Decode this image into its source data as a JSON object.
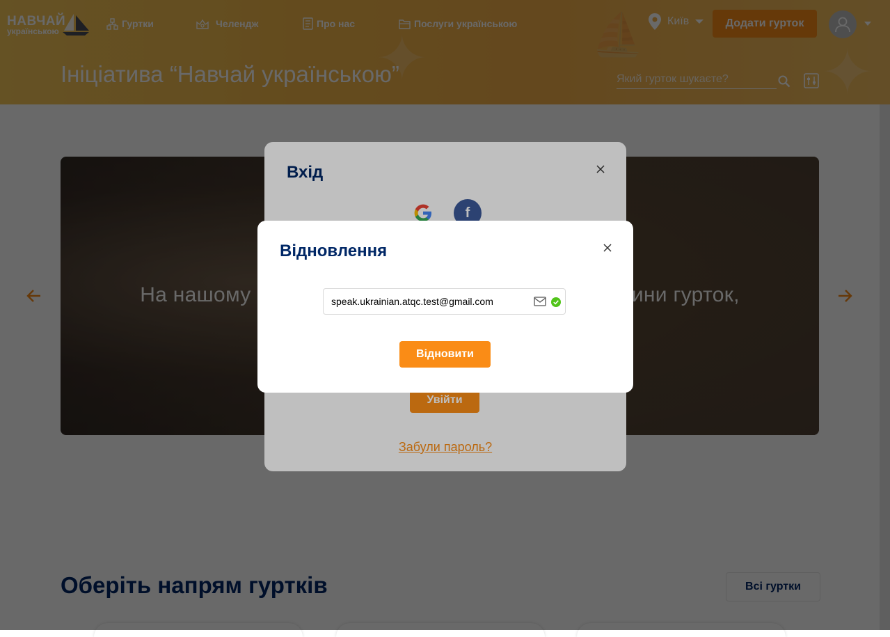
{
  "header": {
    "logo_line1": "НАВЧАЙ",
    "logo_line2": "українською",
    "nav": [
      {
        "label": "Гуртки",
        "icon": "clubs-icon"
      },
      {
        "label": "Челендж",
        "icon": "challenge-icon"
      },
      {
        "label": "Про нас",
        "icon": "about-icon"
      },
      {
        "label": "Послуги українською",
        "icon": "folder-icon"
      }
    ],
    "city": "Київ",
    "add_club_label": "Додати гурток",
    "page_title": "Ініціатива “Навчай українською”",
    "search_placeholder": "Який гурток шукаєте?"
  },
  "carousel": {
    "text_left": "На нашому",
    "text_right": "ини гурток,"
  },
  "section": {
    "title": "Оберіть напрям гуртків",
    "all_clubs_label": "Всі гуртки"
  },
  "login_modal": {
    "title": "Вхід",
    "login_label": "Увійти",
    "forgot_label": "Забули пароль?"
  },
  "recovery_modal": {
    "title": "Відновлення",
    "email_value": "speak.ukrainian.atqc.test@gmail.com",
    "recover_label": "Відновити"
  },
  "colors": {
    "accent": "#fa8c16",
    "title": "#002766",
    "success": "#52c41a"
  }
}
